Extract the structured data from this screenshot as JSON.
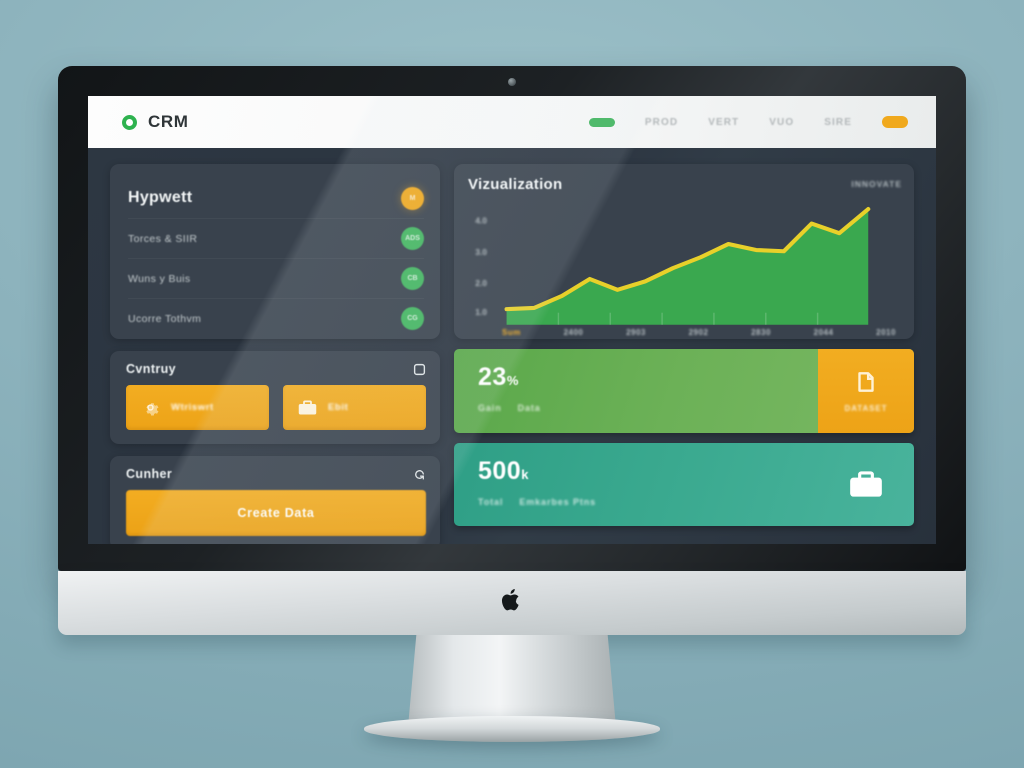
{
  "topbar": {
    "brand_name": "CRM",
    "logo_icon": "circle-ring-logo-icon",
    "nav": [
      {
        "type": "pill",
        "label": "",
        "icon": "green-pill-indicator"
      },
      {
        "type": "link",
        "label": "PROD",
        "icon": ""
      },
      {
        "type": "link",
        "label": "VERT",
        "icon": ""
      },
      {
        "type": "link",
        "label": "VUO",
        "icon": ""
      },
      {
        "type": "link",
        "label": "SIRE",
        "icon": ""
      },
      {
        "type": "pill-orange",
        "label": "",
        "icon": "orange-pill-indicator"
      }
    ]
  },
  "list_panel": {
    "rows": [
      {
        "label": "Hypwett",
        "badge": "M",
        "badge_color": "#efa81e"
      },
      {
        "label": "Torces & SIIR",
        "badge": "ADS",
        "badge_color": "#42b55f"
      },
      {
        "label": "Wuns y Buis",
        "badge": "CB",
        "badge_color": "#42b55f"
      },
      {
        "label": "Ucorre Tothvm",
        "badge": "CG",
        "badge_color": "#42b55f"
      }
    ]
  },
  "actions_panel": {
    "title": "Cvntruy",
    "head_icon": "square-outline-icon",
    "buttons": [
      {
        "label": "Wtriswrt",
        "icon": "gear-icon"
      },
      {
        "label": "Ebit",
        "icon": "briefcase-icon"
      }
    ]
  },
  "create_panel": {
    "title": "Cunher",
    "head_icon": "refresh-icon",
    "button_label": "Create Data"
  },
  "chart_panel": {
    "legend_label": "INNOVATE"
  },
  "chart_data": {
    "type": "area",
    "title": "Vizualization",
    "xlabel": "",
    "ylabel": "",
    "categories": [
      "Sum",
      "2400",
      "2903",
      "2902",
      "2830",
      "2044",
      "2010"
    ],
    "x": [
      0,
      1,
      2,
      3,
      4,
      5,
      6,
      7,
      8,
      9,
      10,
      11,
      12,
      13
    ],
    "values": [
      12,
      13,
      22,
      36,
      28,
      34,
      44,
      52,
      62,
      58,
      57,
      76,
      70,
      86
    ],
    "ytick_labels": [
      "4.0",
      "3.0",
      "2.0",
      "1.0"
    ],
    "ylim": [
      0,
      100
    ],
    "grid": false,
    "legend_position": "top-right",
    "series": [
      {
        "name": "Vizualization",
        "line_color": "#e8d02a",
        "fill_color": "#3aa84f",
        "values": [
          12,
          13,
          22,
          36,
          28,
          34,
          44,
          52,
          62,
          58,
          57,
          76,
          70,
          86
        ]
      }
    ]
  },
  "stat_cards": [
    {
      "value": "23",
      "unit": "%",
      "sub_left": "Gain",
      "sub_right": "Data",
      "bg_color": "#6cb157",
      "side": {
        "label": "DATASET",
        "icon": "document-icon",
        "bg_color": "#eda317"
      }
    },
    {
      "value": "500",
      "unit": "k",
      "sub_left": "Total",
      "sub_right": "Emkarbes Ptns",
      "bg_color": "#3aa98f",
      "side": {
        "label": "",
        "icon": "briefcase-icon",
        "bg_color": ""
      }
    }
  ],
  "hardware": {
    "webcam_icon": "webcam-dot-icon",
    "apple_logo_icon": "apple-logo-icon"
  }
}
